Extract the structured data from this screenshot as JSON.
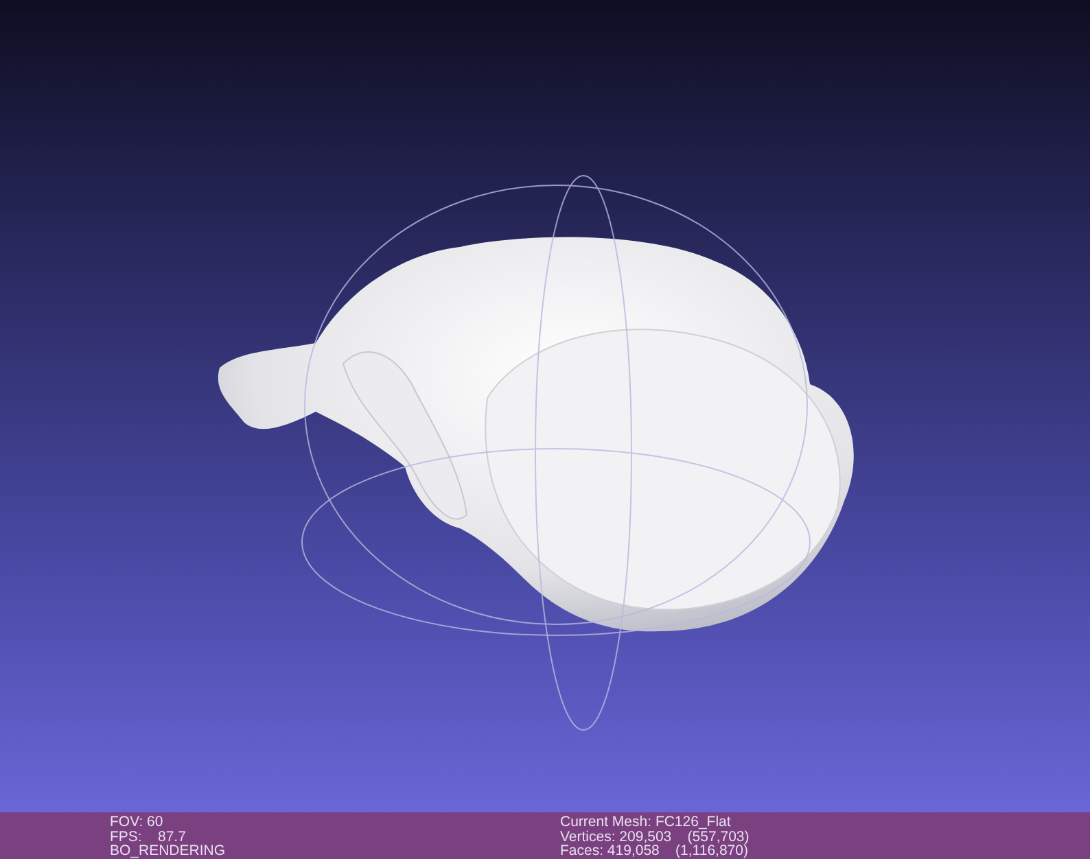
{
  "info_bar": {
    "left": [
      "FOV: 60",
      "FPS:    87.7",
      "BO_RENDERING"
    ],
    "right": [
      "Current Mesh: FC126_Flat",
      "Vertices: 209,503    (557,703)",
      "Faces: 419,058    (1,116,870)"
    ]
  }
}
